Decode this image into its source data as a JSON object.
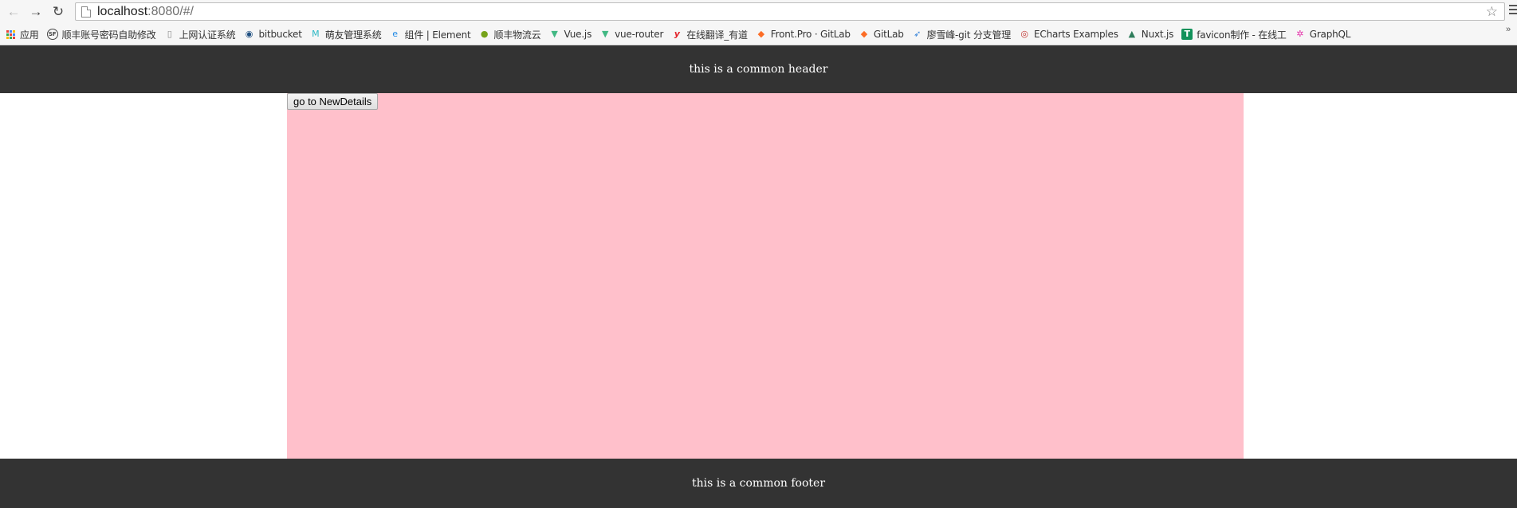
{
  "browser": {
    "url_host": "localhost",
    "url_rest": ":8080/#/",
    "bookmarks": [
      {
        "label": "应用",
        "icon": "apps-grid-icon",
        "color": "#4285f4"
      },
      {
        "label": "顺丰账号密码自助修改",
        "icon": "sf-logo-icon",
        "color": "#444444",
        "glyph": "SF"
      },
      {
        "label": "上网认证系统",
        "icon": "page-icon",
        "color": "#888888",
        "glyph": "▯"
      },
      {
        "label": "bitbucket",
        "icon": "bitbucket-icon",
        "color": "#205081",
        "glyph": "◉"
      },
      {
        "label": "萌友管理系统",
        "icon": "mengyou-icon",
        "color": "#2ab7c4",
        "glyph": "M"
      },
      {
        "label": "组件 | Element",
        "icon": "element-icon",
        "color": "#1e88e5",
        "glyph": "e"
      },
      {
        "label": "顺丰物流云",
        "icon": "sf-cloud-icon",
        "color": "#76a31a",
        "glyph": "●"
      },
      {
        "label": "Vue.js",
        "icon": "vue-icon",
        "color": "#41b883",
        "glyph": "▼"
      },
      {
        "label": "vue-router",
        "icon": "vue-icon",
        "color": "#41b883",
        "glyph": "▼"
      },
      {
        "label": "在线翻译_有道",
        "icon": "youdao-icon",
        "color": "#e3242b",
        "glyph": "y"
      },
      {
        "label": "Front.Pro · GitLab",
        "icon": "gitlab-icon",
        "color": "#fc6d26",
        "glyph": "◆"
      },
      {
        "label": "GitLab",
        "icon": "gitlab-icon",
        "color": "#fc6d26",
        "glyph": "◆"
      },
      {
        "label": "廖雪峰-git 分支管理",
        "icon": "rocket-icon",
        "color": "#2f7fd8",
        "glyph": "➶"
      },
      {
        "label": "ECharts Examples",
        "icon": "echarts-icon",
        "color": "#c23531",
        "glyph": "◎"
      },
      {
        "label": "Nuxt.js",
        "icon": "nuxt-icon",
        "color": "#2e7d5b",
        "glyph": "▲"
      },
      {
        "label": "favicon制作 - 在线工",
        "icon": "favicon-icon",
        "color": "#12925b",
        "glyph": "T"
      },
      {
        "label": "GraphQL",
        "icon": "graphql-icon",
        "color": "#e535ab",
        "glyph": "✲"
      }
    ]
  },
  "header": {
    "text": "this is a common header",
    "bg": "#333333"
  },
  "content": {
    "button_label": "go to NewDetails",
    "bg": "#ffc0cb"
  },
  "footer": {
    "text": "this is a common footer",
    "bg": "#333333"
  }
}
